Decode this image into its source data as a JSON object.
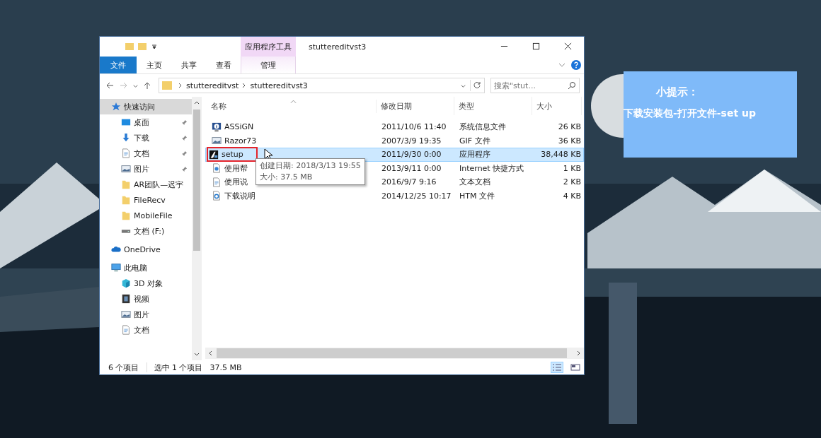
{
  "window": {
    "title": "stuttereditvst3",
    "context_group": "应用程序工具"
  },
  "ribbon_tabs": [
    {
      "label": "文件",
      "kind": "file",
      "selected": false
    },
    {
      "label": "主页",
      "kind": "plain",
      "selected": false
    },
    {
      "label": "共享",
      "kind": "plain",
      "selected": false
    },
    {
      "label": "查看",
      "kind": "plain",
      "selected": false
    },
    {
      "label": "管理",
      "kind": "context",
      "selected": false
    }
  ],
  "address": {
    "path": [
      "stuttereditvst",
      "stuttereditvst3"
    ]
  },
  "search": {
    "placeholder": "搜索\"stut..."
  },
  "sidebar": {
    "items": [
      {
        "label": "快速访问",
        "kind": "star",
        "selected": true,
        "children": [
          {
            "label": "桌面",
            "kind": "desktop",
            "pinned": true
          },
          {
            "label": "下载",
            "kind": "download",
            "pinned": true
          },
          {
            "label": "文档",
            "kind": "document",
            "pinned": true
          },
          {
            "label": "图片",
            "kind": "picture",
            "pinned": true
          },
          {
            "label": "AR团队—迟宇",
            "kind": "folder",
            "pinned": false
          },
          {
            "label": "FileRecv",
            "kind": "folder",
            "pinned": false
          },
          {
            "label": "MobileFile",
            "kind": "folder",
            "pinned": false
          },
          {
            "label": "文档 (F:)",
            "kind": "drive",
            "pinned": false
          }
        ]
      },
      {
        "label": "OneDrive",
        "kind": "cloud",
        "selected": false
      },
      {
        "label": "此电脑",
        "kind": "pc",
        "selected": false,
        "children": [
          {
            "label": "3D 对象",
            "kind": "cube",
            "pinned": false
          },
          {
            "label": "视频",
            "kind": "video",
            "pinned": false
          },
          {
            "label": "图片",
            "kind": "picture",
            "pinned": false
          },
          {
            "label": "文档",
            "kind": "document",
            "pinned": false
          }
        ]
      }
    ]
  },
  "columns": [
    {
      "label": "名称",
      "sorted": true
    },
    {
      "label": "修改日期",
      "sorted": false
    },
    {
      "label": "类型",
      "sorted": false
    },
    {
      "label": "大小",
      "sorted": false
    }
  ],
  "files": [
    {
      "name": "ASSiGN",
      "date": "2011/10/6 11:40",
      "type": "系统信息文件",
      "size": "26 KB",
      "kind": "info",
      "selected": false,
      "highlighted": false
    },
    {
      "name": "Razor73",
      "date": "2007/3/9 19:35",
      "type": "GIF 文件",
      "size": "36 KB",
      "kind": "picture",
      "selected": false,
      "highlighted": false
    },
    {
      "name": "setup",
      "date": "2011/9/30 0:00",
      "type": "应用程序",
      "size": "38,448 KB",
      "kind": "app",
      "selected": true,
      "highlighted": true
    },
    {
      "name": "使用帮",
      "date": "2013/9/11 0:00",
      "type": "Internet 快捷方式",
      "size": "1 KB",
      "kind": "shortcut",
      "selected": false,
      "highlighted": false
    },
    {
      "name": "使用说",
      "date": "2016/9/7 9:16",
      "type": "文本文档",
      "size": "2 KB",
      "kind": "document",
      "selected": false,
      "highlighted": false
    },
    {
      "name": "下载说明",
      "date": "2014/12/25 10:17",
      "type": "HTM 文件",
      "size": "4 KB",
      "kind": "web",
      "selected": false,
      "highlighted": false
    }
  ],
  "tooltip": {
    "lines": [
      "创建日期: 2018/3/13 19:55",
      "大小: 37.5 MB"
    ]
  },
  "status_bar": {
    "count": "6 个项目",
    "selection": "选中 1 个项目",
    "size": "37.5 MB"
  },
  "tip": {
    "title": "小提示：",
    "text": "下载安装包-打开文件-set up"
  }
}
